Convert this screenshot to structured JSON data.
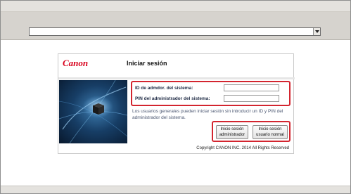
{
  "browser": {
    "address_value": ""
  },
  "login": {
    "brand": "Canon",
    "title": "Iniciar sesión",
    "admin_id_label": "ID de admdor. del sistema:",
    "admin_id_value": "",
    "admin_pin_label": "PIN del administrador del sistema:",
    "admin_pin_value": "",
    "info_text": "Los usuarios generales pueden iniciar sesión sin introducir un ID y PIN del administrador del sistema.",
    "admin_button_line1": "Inicio sesión",
    "admin_button_line2": "administrador",
    "user_button_line1": "Inicio sesión",
    "user_button_line2": "usuario normal",
    "copyright": "Copyright CANON INC. 2014 All Rights Reserved"
  },
  "colors": {
    "brand_red": "#d8001c",
    "highlight_red": "#d3252f",
    "hero_blue": "#1a4a7a"
  }
}
